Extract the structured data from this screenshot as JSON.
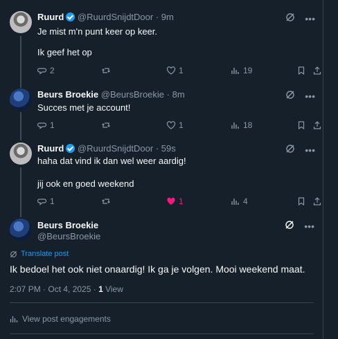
{
  "tweets": [
    {
      "name": "Ruurd",
      "handle": "@RuurdSnijdtDoor",
      "time": "· 9m",
      "lines": [
        "Je mist m'n punt keer op keer.",
        "Ik geef het op"
      ],
      "replies": "2",
      "likes": "1",
      "views": "19"
    },
    {
      "name": "Beurs Broekie",
      "handle": "@BeursBroekie",
      "time": "· 8m",
      "lines": [
        "Succes met je account!"
      ],
      "replies": "1",
      "likes": "1",
      "views": "18"
    },
    {
      "name": "Ruurd",
      "handle": "@RuurdSnijdtDoor",
      "time": "· 59s",
      "lines": [
        "haha dat vind ik dan wel weer aardig!",
        "jij ook en goed weekend"
      ],
      "replies": "1",
      "likes": "1",
      "views": "4"
    }
  ],
  "main": {
    "name": "Beurs Broekie",
    "handle": "@BeursBroekie",
    "translate": "Translate post",
    "text": "Ik bedoel het ook niet onaardig! Ik ga je volgen. Mooi weekend maat.",
    "datetime": "2:07 PM · Oct 4, 2025 · ",
    "views_count": "1",
    "views_label": " View",
    "engagements": "View post engagements"
  },
  "colors": {
    "background": "#15202b",
    "accent": "#1d9bf0",
    "like": "#f91880",
    "muted": "#8b98a5"
  }
}
